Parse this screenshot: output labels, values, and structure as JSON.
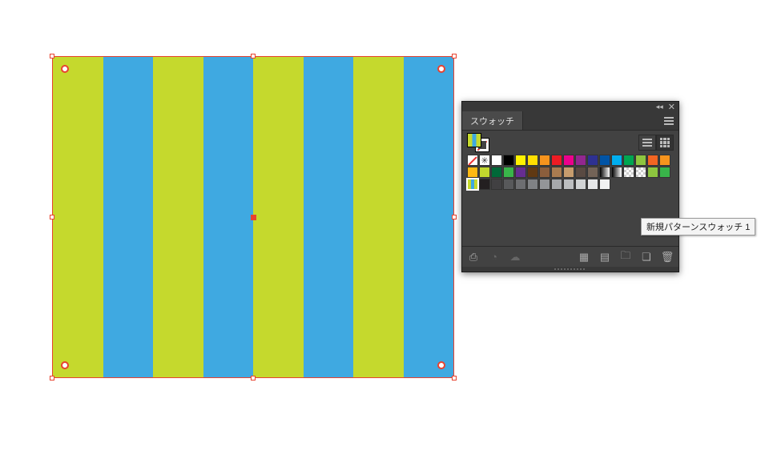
{
  "artwork": {
    "stripe_colors": {
      "green": "#c5d92d",
      "blue": "#3fa9e1"
    },
    "selection_color": "#e8422f"
  },
  "panel": {
    "tab_label": "スウォッチ",
    "tooltip_text": "新規パターンスウォッチ 1",
    "view_mode": "grid",
    "swatches": [
      {
        "t": "none"
      },
      {
        "t": "reg"
      },
      {
        "c": "#ffffff"
      },
      {
        "c": "#000000"
      },
      {
        "c": "#fff200"
      },
      {
        "c": "#ffde00"
      },
      {
        "c": "#f7941d"
      },
      {
        "c": "#ed1c24"
      },
      {
        "c": "#ec008c"
      },
      {
        "c": "#92278f"
      },
      {
        "c": "#2e3192"
      },
      {
        "c": "#0054a6"
      },
      {
        "c": "#00aeef"
      },
      {
        "c": "#00a651"
      },
      {
        "c": "#8dc63f"
      },
      {
        "c": "#f26522"
      },
      {
        "c": "#f7941d"
      },
      {
        "c": "#fdb913"
      },
      {
        "c": "#c2d82e"
      },
      {
        "c": "#006838"
      },
      {
        "c": "#39b54a"
      },
      {
        "c": "#662d91"
      },
      {
        "c": "#603913"
      },
      {
        "c": "#8b5e3c"
      },
      {
        "c": "#a97c50"
      },
      {
        "c": "#c69c6d"
      },
      {
        "c": "#594a42"
      },
      {
        "c": "#736357"
      },
      {
        "t": "grad"
      },
      {
        "t": "grad"
      },
      {
        "t": "pat"
      },
      {
        "t": "pat"
      },
      {
        "c": "#8dc63f"
      },
      {
        "c": "#39b54a"
      },
      {
        "t": "stripes",
        "selected": true
      },
      {
        "c": "#231f20"
      },
      {
        "c": "#414042"
      },
      {
        "c": "#58595b"
      },
      {
        "c": "#6d6e71"
      },
      {
        "c": "#808285"
      },
      {
        "c": "#939598"
      },
      {
        "c": "#a7a9ac"
      },
      {
        "c": "#bcbec0"
      },
      {
        "c": "#d1d3d4"
      },
      {
        "c": "#e6e7e8"
      },
      {
        "c": "#f1f2f2"
      }
    ],
    "footer_icons": {
      "libraries": "library-icon",
      "kind_menu": "swatch-kind-icon",
      "cloud": "cloud-icon",
      "options": "swatch-options-icon",
      "new_group": "new-group-icon",
      "folder": "folder-icon",
      "new_swatch": "new-swatch-icon",
      "delete": "trash-icon"
    }
  }
}
